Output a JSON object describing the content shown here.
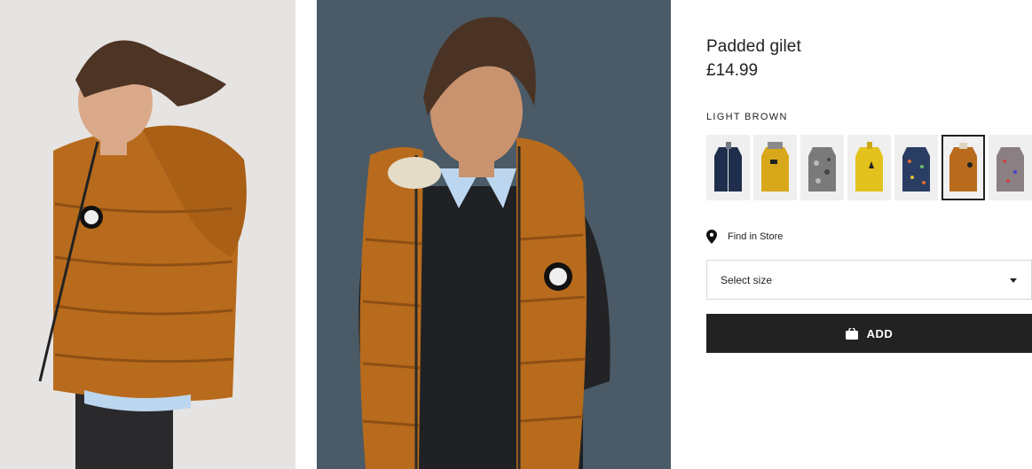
{
  "product": {
    "title": "Padded gilet",
    "price": "£14.99",
    "color_name": "LIGHT BROWN"
  },
  "images": [
    {
      "name": "side view of child wearing light brown padded gilet",
      "background": "#e6e4e2"
    },
    {
      "name": "front view of child wearing light brown padded gilet",
      "background": "#4a5a66"
    }
  ],
  "swatches": [
    {
      "color": "#1f2e4d",
      "label": "navy"
    },
    {
      "color": "#d9a81a",
      "label": "mustard"
    },
    {
      "color": "#7a7a7a",
      "label": "grey patterned"
    },
    {
      "color": "#e4c21e",
      "label": "yellow"
    },
    {
      "color": "#2a3d63",
      "label": "navy patterned"
    },
    {
      "color": "#b86b1c",
      "label": "light brown",
      "selected": true
    },
    {
      "color": "#8a7f82",
      "label": "multicolour patterned"
    }
  ],
  "find_in_store": {
    "label": "Find in Store",
    "icon": "location-pin-icon"
  },
  "size_select": {
    "label": "Select size",
    "icon": "chevron-down-icon"
  },
  "add_button": {
    "label": "ADD",
    "icon": "shopping-bag-icon"
  },
  "colors": {
    "accent": "#222222",
    "gilet": "#b86b1c"
  }
}
